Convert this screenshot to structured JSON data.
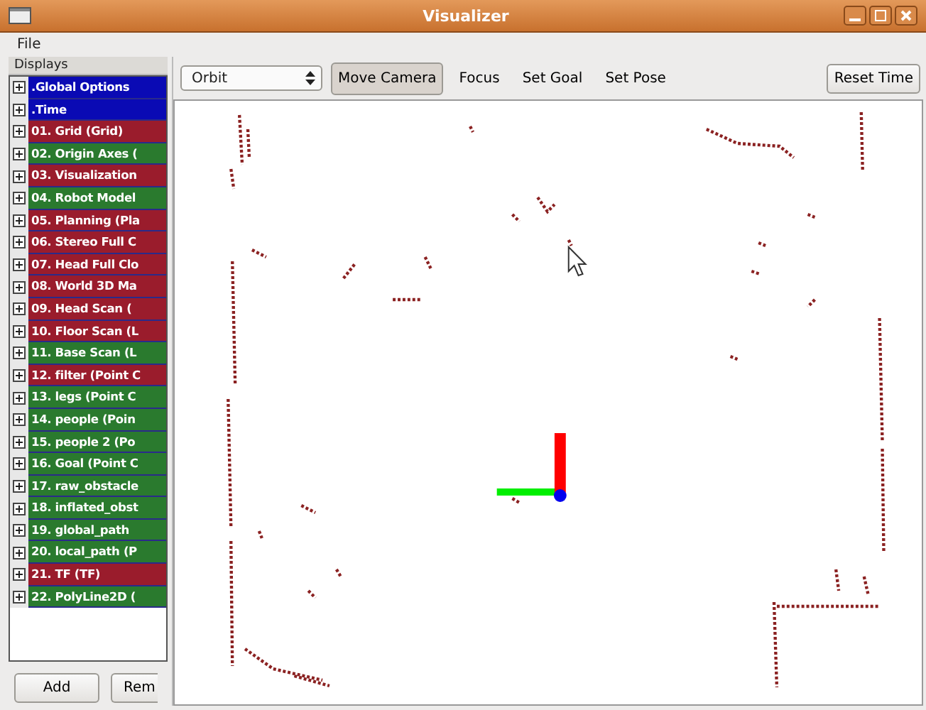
{
  "window": {
    "title": "Visualizer"
  },
  "menu": [
    "File"
  ],
  "displays": {
    "heading": "Displays",
    "items": [
      {
        "label": ".Global Options",
        "color": "#0a0ab4"
      },
      {
        "label": ".Time",
        "color": "#0a0ab4"
      },
      {
        "label": "01. Grid (Grid)",
        "color": "#9a1c2c"
      },
      {
        "label": "02. Origin Axes (",
        "color": "#2a7a2e"
      },
      {
        "label": "03. Visualization",
        "color": "#9a1c2c"
      },
      {
        "label": "04. Robot Model",
        "color": "#2a7a2e"
      },
      {
        "label": "05. Planning (Pla",
        "color": "#9a1c2c"
      },
      {
        "label": "06. Stereo Full C",
        "color": "#9a1c2c"
      },
      {
        "label": "07. Head Full Clo",
        "color": "#9a1c2c"
      },
      {
        "label": "08. World 3D Ma",
        "color": "#9a1c2c"
      },
      {
        "label": "09. Head Scan (",
        "color": "#9a1c2c"
      },
      {
        "label": "10. Floor Scan (L",
        "color": "#9a1c2c"
      },
      {
        "label": "11. Base Scan (L",
        "color": "#2a7a2e"
      },
      {
        "label": "12. filter (Point C",
        "color": "#9a1c2c"
      },
      {
        "label": "13. legs (Point C",
        "color": "#2a7a2e"
      },
      {
        "label": "14. people (Poin",
        "color": "#2a7a2e"
      },
      {
        "label": "15. people 2 (Po",
        "color": "#2a7a2e"
      },
      {
        "label": "16. Goal (Point C",
        "color": "#2a7a2e"
      },
      {
        "label": "17. raw_obstacle",
        "color": "#2a7a2e"
      },
      {
        "label": "18. inflated_obst",
        "color": "#2a7a2e"
      },
      {
        "label": "19. global_path",
        "color": "#2a7a2e"
      },
      {
        "label": "20. local_path (P",
        "color": "#2a7a2e"
      },
      {
        "label": "21. TF (TF)",
        "color": "#9a1c2c"
      },
      {
        "label": "22. PolyLine2D (",
        "color": "#2a7a2e"
      }
    ],
    "buttons": [
      "Add",
      "Rem"
    ]
  },
  "toolbar": {
    "view_mode": "Orbit",
    "tools": [
      {
        "label": "Move Camera",
        "selected": true
      },
      {
        "label": "Focus",
        "selected": false
      },
      {
        "label": "Set Goal",
        "selected": false
      },
      {
        "label": "Set Pose",
        "selected": false
      }
    ],
    "reset": "Reset Time"
  }
}
